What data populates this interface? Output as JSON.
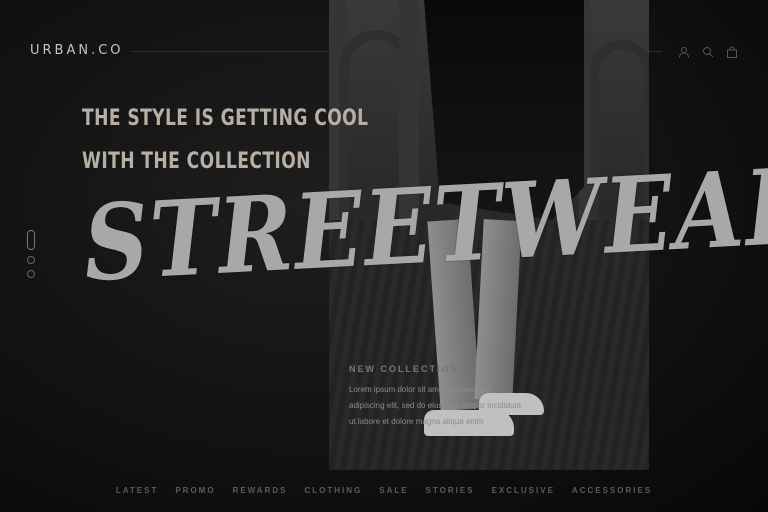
{
  "header": {
    "brand": "URBAN.CO",
    "icons": [
      "user-icon",
      "search-icon",
      "bag-icon"
    ]
  },
  "hero": {
    "headline_line1": "THE STYLE IS GETTING COOL",
    "headline_line2": "WITH THE COLLECTION",
    "script_title": "STREETWEAR"
  },
  "collection": {
    "label": "NEW COLLECTION",
    "body": "Lorem ipsum dolor sit amet, consectetur adipiscing elit, sed do eiusmod tempor incididunt ut labore et dolore magna aliqua enim"
  },
  "nav": {
    "items": [
      "LATEST",
      "PROMO",
      "REWARDS",
      "CLOTHING",
      "SALE",
      "STORIES",
      "EXCLUSIVE",
      "ACCESSORIES"
    ]
  }
}
